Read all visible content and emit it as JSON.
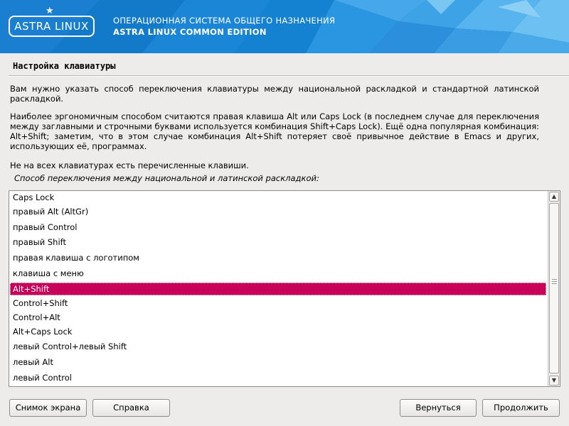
{
  "header": {
    "logo": "ASTRA LINUX",
    "title_line1": "ОПЕРАЦИОННАЯ СИСТЕМА ОБЩЕГО НАЗНАЧЕНИЯ",
    "title_line2": "ASTRA LINUX COMMON EDITION",
    "brand_color": "#1478c8"
  },
  "page": {
    "title": "Настройка клавиатуры",
    "paragraph1": "Вам нужно указать способ переключения клавиатуры между национальной раскладкой и стандартной латинской раскладкой.",
    "paragraph2": "Наиболее эргономичным способом считаются правая клавиша Alt или Caps Lock (в последнем случае для переключения между заглавными и строчными буквами используется комбинация Shift+Caps Lock). Ещё одна популярная комбинация: Alt+Shift; заметим, что в этом случае комбинация Alt+Shift потеряет своё привычное действие в Emacs и других, использующих её, программах.",
    "paragraph3": "Не на всех клавиатурах есть перечисленные клавиши.",
    "prompt": "Способ переключения между национальной и латинской раскладкой:"
  },
  "list": {
    "selected_color": "#c9005a",
    "selected_index": 6,
    "items": [
      "Caps Lock",
      "правый Alt (AltGr)",
      "правый Control",
      "правый Shift",
      "правая клавиша с логотипом",
      "клавиша с меню",
      "Alt+Shift",
      "Control+Shift",
      "Control+Alt",
      "Alt+Caps Lock",
      "левый Control+левый Shift",
      "левый Alt",
      "левый Control"
    ]
  },
  "buttons": {
    "screenshot": "Снимок экрана",
    "help": "Справка",
    "back": "Вернуться",
    "continue": "Продолжить"
  },
  "icons": {
    "logo_star": "star-icon",
    "scroll_up": "arrow-up-icon",
    "scroll_down": "arrow-down-icon"
  }
}
